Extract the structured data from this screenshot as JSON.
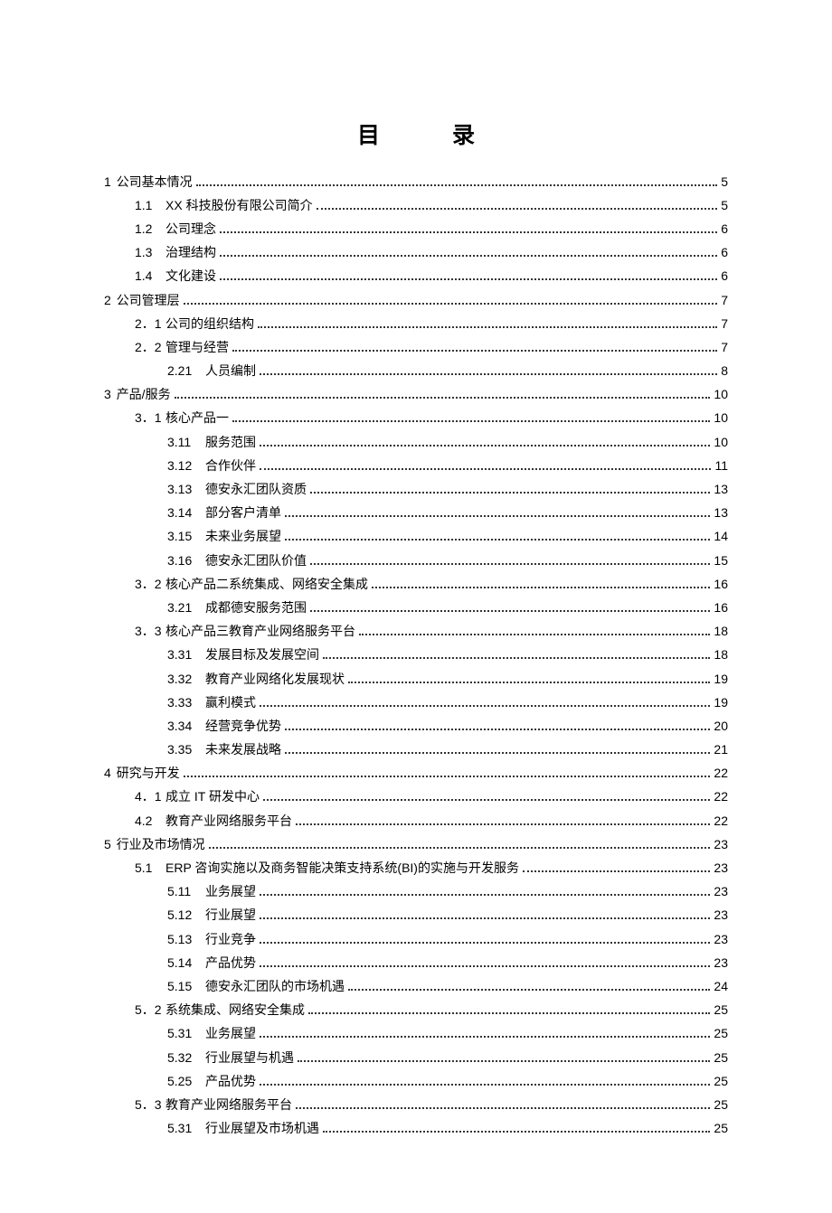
{
  "title": "目录",
  "entries": [
    {
      "level": 1,
      "num": "1",
      "text": "公司基本情况",
      "page": "5"
    },
    {
      "level": 2,
      "num": "1.1",
      "text": "XX 科技股份有限公司简介",
      "page": "5"
    },
    {
      "level": 2,
      "num": "1.2",
      "text": "公司理念",
      "page": "6"
    },
    {
      "level": 2,
      "num": "1.3",
      "text": "治理结构",
      "page": "6"
    },
    {
      "level": 2,
      "num": "1.4",
      "text": "文化建设",
      "page": "6"
    },
    {
      "level": 1,
      "num": "2",
      "text": "公司管理层",
      "page": "7"
    },
    {
      "level": 2,
      "num": "2．1",
      "text": "公司的组织结构",
      "page": "7"
    },
    {
      "level": 2,
      "num": "2．2",
      "text": "管理与经营",
      "page": "7"
    },
    {
      "level": 3,
      "num": "2.21",
      "text": "人员编制",
      "page": "8"
    },
    {
      "level": 1,
      "num": "3",
      "text": "产品/服务",
      "page": "10"
    },
    {
      "level": 2,
      "num": "3．1",
      "text": "核心产品一",
      "page": "10"
    },
    {
      "level": 3,
      "num": "3.11",
      "text": "服务范围",
      "page": "10"
    },
    {
      "level": 3,
      "num": "3.12",
      "text": "合作伙伴",
      "page": "11"
    },
    {
      "level": 3,
      "num": "3.13",
      "text": "德安永汇团队资质",
      "page": "13"
    },
    {
      "level": 3,
      "num": "3.14",
      "text": "部分客户清单",
      "page": "13"
    },
    {
      "level": 3,
      "num": "3.15",
      "text": "未来业务展望",
      "page": "14"
    },
    {
      "level": 3,
      "num": "3.16",
      "text": "德安永汇团队价值",
      "page": "15"
    },
    {
      "level": 2,
      "num": "3．2",
      "text": "核心产品二系统集成、网络安全集成",
      "page": "16"
    },
    {
      "level": 3,
      "num": "3.21",
      "text": "成都德安服务范围",
      "page": "16"
    },
    {
      "level": 2,
      "num": "3．3",
      "text": "核心产品三教育产业网络服务平台",
      "page": "18"
    },
    {
      "level": 3,
      "num": "3.31",
      "text": "发展目标及发展空间",
      "page": "18"
    },
    {
      "level": 3,
      "num": "3.32",
      "text": "教育产业网络化发展现状",
      "page": "19"
    },
    {
      "level": 3,
      "num": "3.33",
      "text": "赢利模式",
      "page": "19"
    },
    {
      "level": 3,
      "num": "3.34",
      "text": "经营竞争优势",
      "page": "20"
    },
    {
      "level": 3,
      "num": "3.35",
      "text": "未来发展战略",
      "page": "21"
    },
    {
      "level": 1,
      "num": "4",
      "text": "研究与开发",
      "page": "22"
    },
    {
      "level": 2,
      "num": "4．1",
      "text": "成立 IT 研发中心",
      "page": "22"
    },
    {
      "level": 2,
      "num": "4.2",
      "text": "教育产业网络服务平台",
      "page": "22"
    },
    {
      "level": 1,
      "num": "5",
      "text": "行业及市场情况",
      "page": "23"
    },
    {
      "level": 2,
      "num": "5.1",
      "text": "ERP 咨询实施以及商务智能决策支持系统(BI)的实施与开发服务",
      "page": "23"
    },
    {
      "level": 3,
      "num": "5.11",
      "text": "业务展望",
      "page": "23"
    },
    {
      "level": 3,
      "num": "5.12",
      "text": "行业展望",
      "page": "23"
    },
    {
      "level": 3,
      "num": "5.13",
      "text": "行业竞争",
      "page": "23"
    },
    {
      "level": 3,
      "num": "5.14",
      "text": "产品优势",
      "page": "23"
    },
    {
      "level": 3,
      "num": "5.15",
      "text": "德安永汇团队的市场机遇",
      "page": "24"
    },
    {
      "level": 2,
      "num": "5．2",
      "text": "系统集成、网络安全集成",
      "page": "25"
    },
    {
      "level": 3,
      "num": "5.31",
      "text": "业务展望",
      "page": "25"
    },
    {
      "level": 3,
      "num": "5.32",
      "text": "行业展望与机遇",
      "page": "25"
    },
    {
      "level": 3,
      "num": "5.25",
      "text": "产品优势",
      "page": "25"
    },
    {
      "level": 2,
      "num": "5．3",
      "text": "教育产业网络服务平台",
      "page": "25"
    },
    {
      "level": 3,
      "num": "5.31",
      "text": "行业展望及市场机遇",
      "page": "25"
    }
  ]
}
